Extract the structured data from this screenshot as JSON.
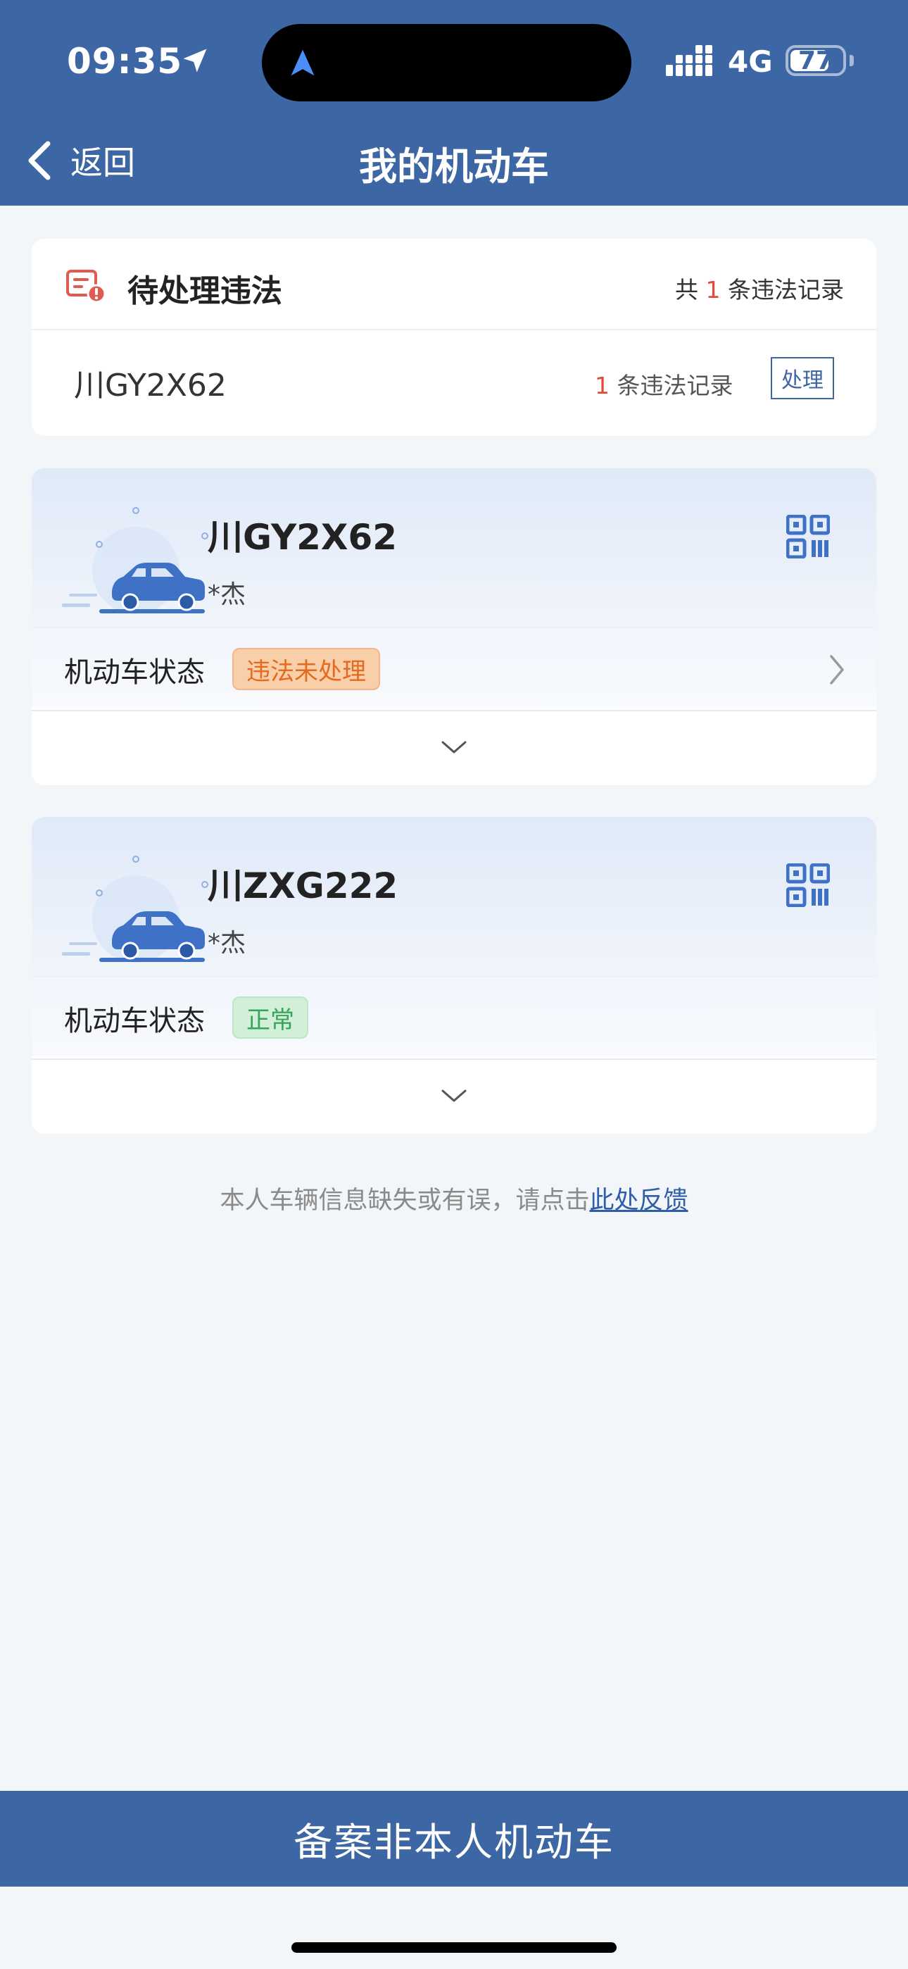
{
  "status_bar": {
    "time": "09:35",
    "network": "4G",
    "battery": "77",
    "battery_level": 0.77
  },
  "nav": {
    "back_label": "返回",
    "title": "我的机动车"
  },
  "violations": {
    "title": "待处理违法",
    "total_prefix": "共",
    "total_count": "1",
    "total_suffix": "条违法记录",
    "item": {
      "plate": "川GY2X62",
      "count": "1",
      "count_suffix": "条违法记录",
      "action_label": "处理"
    }
  },
  "vehicles": [
    {
      "plate": "川GY2X62",
      "owner": "*杰",
      "status_label": "机动车状态",
      "status": "违法未处理",
      "status_type": "warning"
    },
    {
      "plate": "川ZXG222",
      "owner": "*杰",
      "status_label": "机动车状态",
      "status": "正常",
      "status_type": "normal"
    }
  ],
  "feedback": {
    "text": "本人车辆信息缺失或有误，请点击",
    "link": "此处反馈"
  },
  "bottom_button": "备案非本人机动车",
  "colors": {
    "brand": "#3d66a4",
    "warning_bg": "#f9cfa9",
    "warning_text": "#e46a1d",
    "normal_bg": "#d2efd8",
    "normal_text": "#36a55b",
    "alert_red": "#e24a3b"
  }
}
